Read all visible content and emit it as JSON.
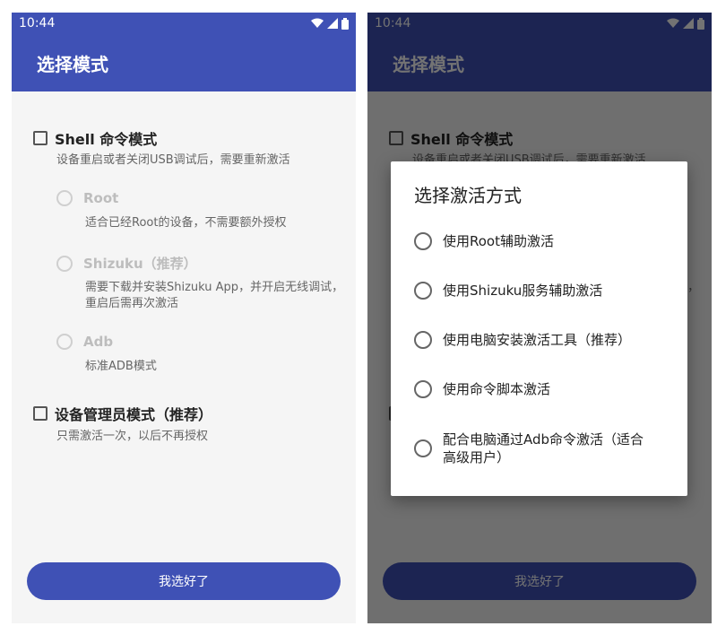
{
  "status": {
    "time": "10:44"
  },
  "app": {
    "title": "选择模式"
  },
  "shell_mode": {
    "label": "Shell 命令模式",
    "desc": "设备重启或者关闭USB调试后，需要重新激活",
    "options": [
      {
        "label": "Root",
        "desc": "适合已经Root的设备，不需要额外授权"
      },
      {
        "label": "Shizuku（推荐）",
        "desc": "需要下载并安装Shizuku App，并开启无线调试，重启后需再次激活"
      },
      {
        "label": "Adb",
        "desc": "标准ADB模式"
      }
    ]
  },
  "device_admin_mode": {
    "label": "设备管理员模式（推荐）",
    "desc": "只需激活一次，以后不再授权"
  },
  "confirm_button": {
    "label": "我选好了"
  },
  "dialog": {
    "title": "选择激活方式",
    "options": [
      "使用Root辅助激活",
      "使用Shizuku服务辅助激活",
      "使用电脑安装激活工具（推荐）",
      "使用命令脚本激活",
      "配合电脑通过Adb命令激活（适合高级用户）"
    ]
  },
  "colors": {
    "primary": "#3f51b5",
    "background": "#f5f5f5"
  }
}
